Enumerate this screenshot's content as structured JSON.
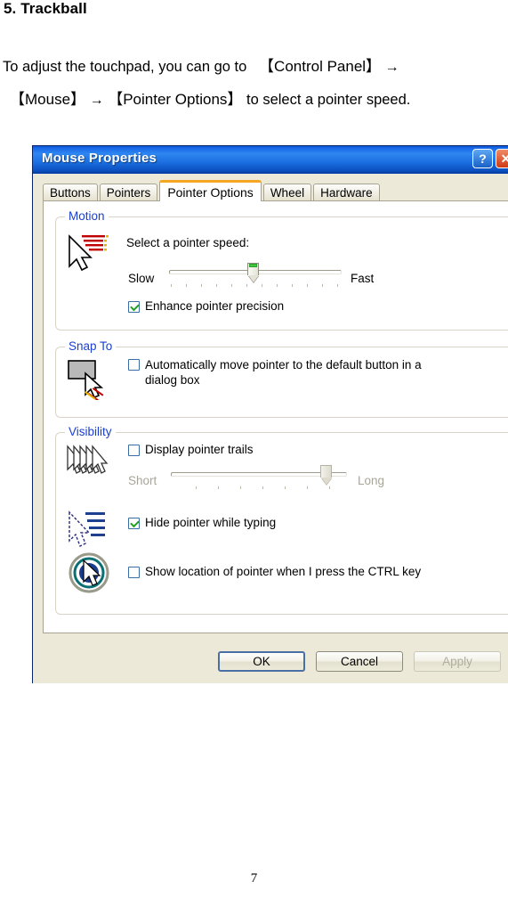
{
  "document": {
    "heading": "5. Trackball",
    "paragraph_line1_a": "To adjust the touchpad, you can go to",
    "paragraph_line1_b": "【Control Panel】",
    "arrow1": "→",
    "paragraph_line2_a": "【Mouse】",
    "arrow2": "→",
    "paragraph_line2_b": "【Pointer Options】",
    "paragraph_line2_c": "to select a pointer speed.",
    "page_number": "7"
  },
  "dialog": {
    "title": "Mouse Properties",
    "titlebar_buttons": {
      "help": "?",
      "close": "✕"
    },
    "tabs": [
      {
        "label": "Buttons",
        "active": false
      },
      {
        "label": "Pointers",
        "active": false
      },
      {
        "label": "Pointer Options",
        "active": true
      },
      {
        "label": "Wheel",
        "active": false
      },
      {
        "label": "Hardware",
        "active": false
      }
    ],
    "motion": {
      "legend": "Motion",
      "speed_label": "Select a pointer speed:",
      "slow_label": "Slow",
      "fast_label": "Fast",
      "speed_value_percent": 50,
      "enhance_label": "Enhance pointer precision",
      "enhance_checked": true
    },
    "snap_to": {
      "legend": "Snap To",
      "label_line1": "Automatically move pointer to the default button in a",
      "label_line2": "dialog box",
      "checked": false
    },
    "visibility": {
      "legend": "Visibility",
      "trails_label": "Display pointer trails",
      "trails_checked": false,
      "short_label": "Short",
      "long_label": "Long",
      "trails_value_percent": 88,
      "hide_label": "Hide pointer while typing",
      "hide_checked": true,
      "ctrl_label": "Show location of pointer when I press the CTRL key",
      "ctrl_checked": false
    },
    "buttons": {
      "ok": "OK",
      "cancel": "Cancel",
      "apply": "Apply"
    },
    "colors": {
      "titlebar_blue": "#1868e8",
      "legend_blue": "#1a3fd0",
      "active_tab_orange": "#f5a623",
      "check_green": "#22a022",
      "dialog_face": "#ece9d8"
    }
  }
}
